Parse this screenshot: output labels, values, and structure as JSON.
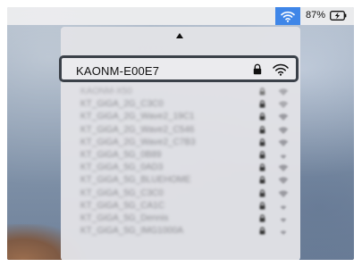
{
  "menubar": {
    "wifi_icon": "wifi-icon",
    "battery_percent": "87%",
    "battery_icon": "battery-charging-icon",
    "highlight_color": "#3f86e8"
  },
  "wifi_menu": {
    "selected_network": {
      "name": "KAONM-E00E7",
      "lock_icon": "lock-icon",
      "signal_icon": "wifi-signal-icon"
    },
    "networks": [
      {
        "name": "KAONM-X50"
      },
      {
        "name": "KT_GiGA_2G_C3C0"
      },
      {
        "name": "KT_GiGA_2G_Wave2_19C1"
      },
      {
        "name": "KT_GiGA_2G_Wave2_C546"
      },
      {
        "name": "KT_GiGA_2G_Wave2_C7B3"
      },
      {
        "name": "KT_GiGA_5G_0B89"
      },
      {
        "name": "KT_GiGA_5G_0AD3"
      },
      {
        "name": "KT_GiGA_5G_BLUEHOME"
      },
      {
        "name": "KT_GiGA_5G_C3C0"
      },
      {
        "name": "KT_GiGA_5G_CA1C"
      },
      {
        "name": "KT_GiGA_5G_Dennis"
      },
      {
        "name": "KT_GiGA_5G_IMG1000A"
      }
    ]
  }
}
